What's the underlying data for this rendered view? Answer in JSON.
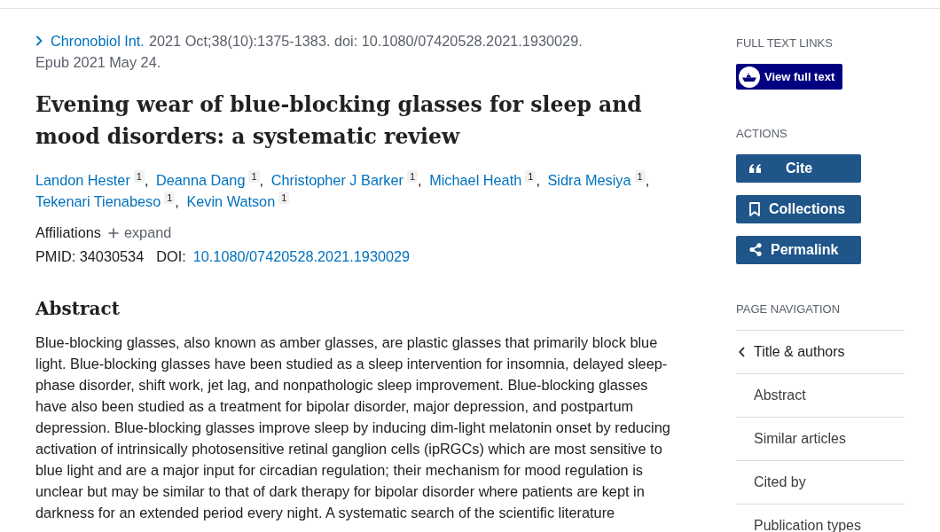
{
  "citation": {
    "journal": "Chronobiol Int.",
    "details": "2021 Oct;38(10):1375-1383. doi: 10.1080/07420528.2021.1930029.",
    "epub": "Epub 2021 May 24."
  },
  "title": "Evening wear of blue-blocking glasses for sleep and mood disorders: a systematic review",
  "authors": [
    {
      "name": "Landon Hester",
      "affiliation": "1",
      "separator": ","
    },
    {
      "name": "Deanna Dang",
      "affiliation": "1",
      "separator": ","
    },
    {
      "name": "Christopher J Barker",
      "affiliation": "1",
      "separator": ","
    },
    {
      "name": "Michael Heath",
      "affiliation": "1",
      "separator": ","
    },
    {
      "name": "Sidra Mesiya",
      "affiliation": "1",
      "separator": ","
    },
    {
      "name": "Tekenari Tienabeso",
      "affiliation": "1",
      "separator": ","
    },
    {
      "name": "Kevin Watson",
      "affiliation": "1"
    }
  ],
  "affiliations": {
    "label": "Affiliations",
    "expand": "expand"
  },
  "identifiers": {
    "pmid": "PMID: 34030534",
    "doi_label": "DOI:",
    "doi": "10.1080/07420528.2021.1930029"
  },
  "abstract": {
    "heading": "Abstract",
    "text": "Blue-blocking glasses, also known as amber glasses, are plastic glasses that primarily block blue light. Blue-blocking glasses have been studied as a sleep intervention for insomnia, delayed sleep-phase disorder, shift work, jet lag, and nonpathologic sleep improvement. Blue-blocking glasses have also been studied as a treatment for bipolar disorder, major depression, and postpartum depression. Blue-blocking glasses improve sleep by inducing dim-light melatonin onset by reducing activation of intrinsically photosensitive retinal ganglion cells (ipRGCs) which are most sensitive to blue light and are a major input for circadian regulation; their mechanism for mood regulation is unclear but may be similar to that of dark therapy for bipolar disorder where patients are kept in darkness for an extended period every night. A systematic search of the scientific literature"
  },
  "sidebar": {
    "full_text_links": {
      "heading": "FULL TEXT LINKS",
      "button": "View full text"
    },
    "actions": {
      "heading": "ACTIONS",
      "buttons": [
        {
          "kind": "cite",
          "label": "Cite"
        },
        {
          "kind": "collections",
          "label": "Collections"
        },
        {
          "kind": "permalink",
          "label": "Permalink"
        }
      ]
    },
    "page_navigation": {
      "heading": "PAGE NAVIGATION",
      "items": [
        {
          "label": "Title & authors",
          "selected": true
        },
        {
          "label": "Abstract",
          "selected": false
        },
        {
          "label": "Similar articles",
          "selected": false
        },
        {
          "label": "Cited by",
          "selected": false
        },
        {
          "label": "Publication types",
          "selected": false
        }
      ]
    }
  }
}
